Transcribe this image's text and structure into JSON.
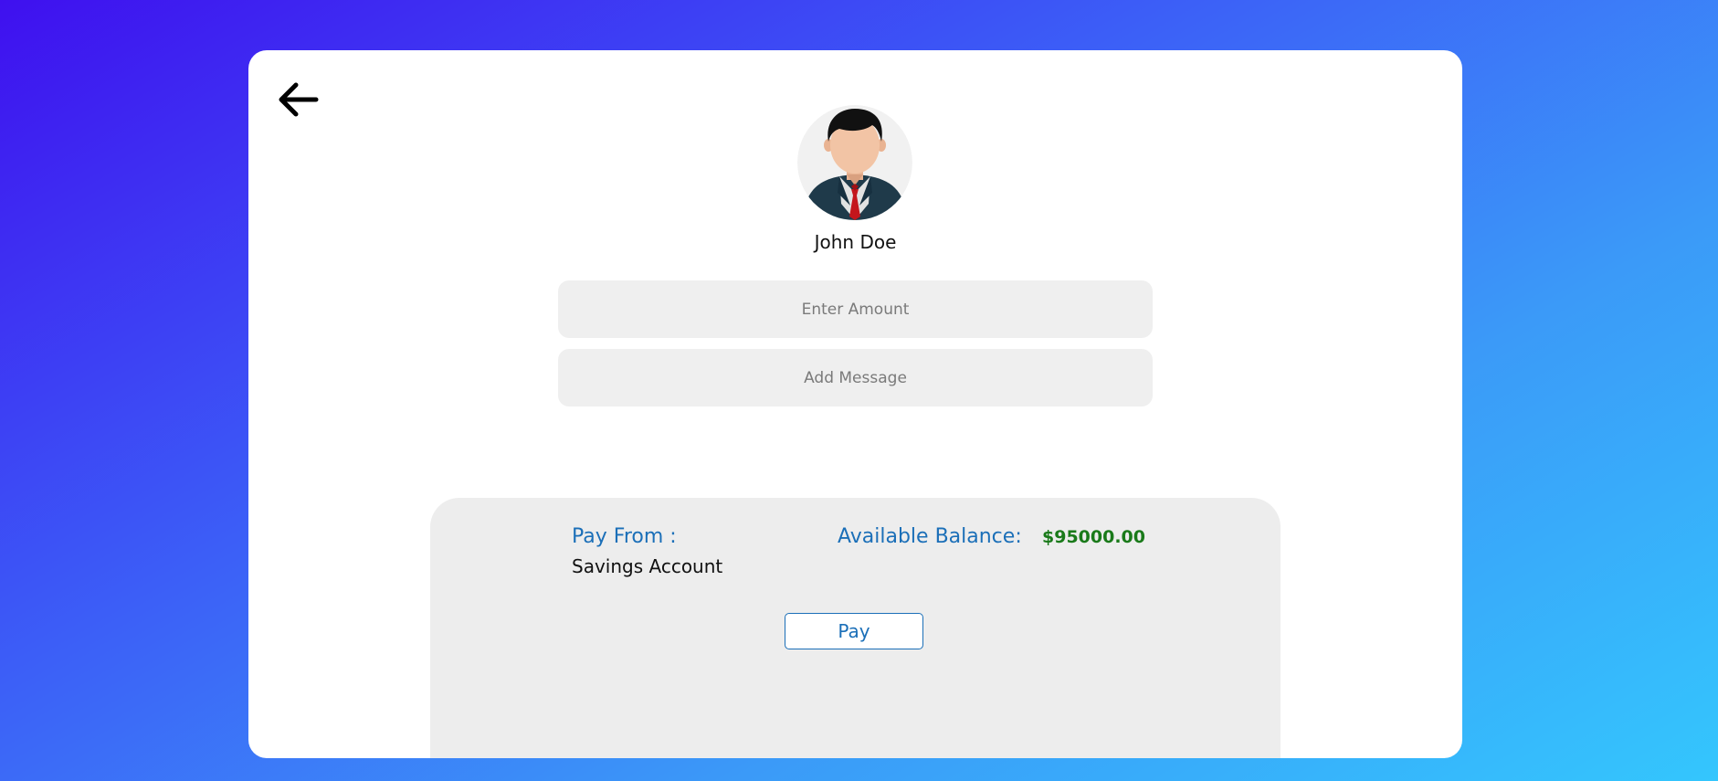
{
  "app": {
    "back_icon": "arrow-left-icon",
    "avatar_icon": "businessman-avatar-icon"
  },
  "recipient": {
    "name": "John Doe"
  },
  "form": {
    "amount_placeholder": "Enter Amount",
    "message_placeholder": "Add Message"
  },
  "payment": {
    "pay_from_label": "Pay From :",
    "pay_from_value": "Savings Account",
    "balance_label": "Available Balance:",
    "balance_value": "$95000.00",
    "pay_label": "Pay"
  },
  "colors": {
    "accent": "#1b6fb8",
    "balance": "#1a7a1a",
    "field_bg": "#efefef",
    "panel_bg": "#ededed"
  }
}
